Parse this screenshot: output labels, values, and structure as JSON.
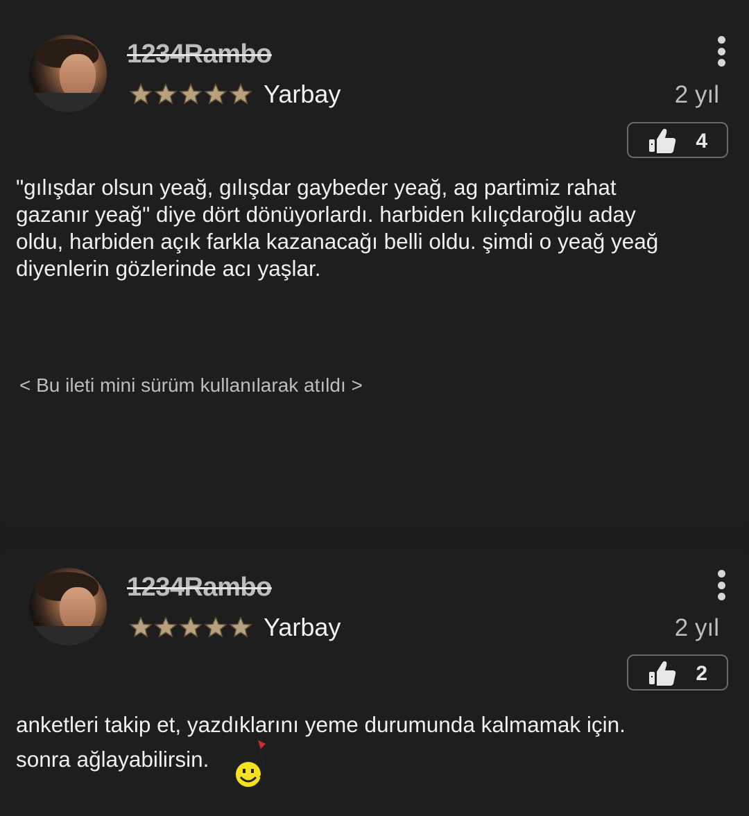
{
  "posts": [
    {
      "username": "1234Rambo",
      "rank": "Yarbay",
      "time": "2 yıl",
      "likes": "4",
      "body_lines": [
        "\"gılışdar olsun yeağ, gılışdar gaybeder yeağ, ag partimiz rahat",
        "gazanır yeağ\" diye dört dönüyorlardı. harbiden kılıçdaroğlu aday",
        "oldu, harbiden açık farkla kazanacağı belli oldu. şimdi o yeağ yeağ",
        "diyenlerin gözlerinde acı yaşlar."
      ],
      "footer_note": "< Bu ileti mini sürüm kullanılarak atıldı >"
    },
    {
      "username": "1234Rambo",
      "rank": "Yarbay",
      "time": "2 yıl",
      "likes": "2",
      "body_lines": [
        "anketleri takip et, yazdıklarını yeme durumunda kalmamak için.",
        "sonra ağlayabilirsin."
      ],
      "emoticon": "smiley-with-flag-icon"
    }
  ],
  "colors": {
    "background": "#1c1c1c",
    "star": "#b8a27e",
    "text": "#f0f0f0",
    "muted": "#bdbdbd"
  }
}
